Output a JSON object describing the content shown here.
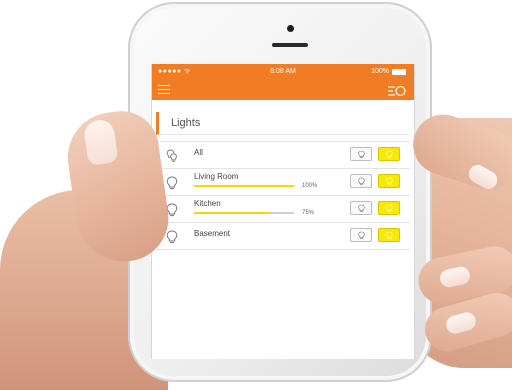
{
  "status_bar": {
    "carrier": "●●●●● ᯤ",
    "time": "8:08 AM",
    "battery": "100%"
  },
  "app_bar": {
    "menu_icon": "hamburger-menu-icon",
    "filter_icon": "list-filter-icon"
  },
  "section": {
    "title": "Lights"
  },
  "lights": [
    {
      "label": "All",
      "icon": "bulbs-group-icon",
      "level": null,
      "level_label": ""
    },
    {
      "label": "Living Room",
      "icon": "bulb-icon",
      "level": 1.0,
      "level_label": "100%"
    },
    {
      "label": "Kitchen",
      "icon": "bulb-icon",
      "level": 0.75,
      "level_label": "75%"
    },
    {
      "label": "Basement",
      "icon": "bulb-icon",
      "level": null,
      "level_label": ""
    }
  ],
  "colors": {
    "accent": "#f07d23",
    "on_button": "#f7ea00",
    "slider": "#f0d800"
  }
}
